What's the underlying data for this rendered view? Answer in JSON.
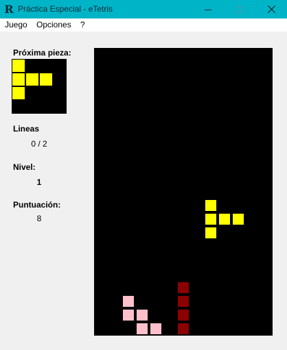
{
  "window": {
    "title": "Práctica Especial - eTetris",
    "icon": "app-logo-icon",
    "icon_glyph": "R",
    "colors": {
      "titlebar": "#00b4c8"
    }
  },
  "menu": {
    "items": [
      {
        "label": "Juego"
      },
      {
        "label": "Opciones"
      },
      {
        "label": "?"
      }
    ]
  },
  "side_panel": {
    "next_piece_label": "Próxima pieza:",
    "lines_label": "Lineas",
    "lines_value": "0 / 2",
    "level_label": "Nivel:",
    "level_value": "1",
    "score_label": "Puntuación:",
    "score_value": "8"
  },
  "next_piece": {
    "grid_size": 4,
    "color": "#ffff00",
    "cells": [
      [
        0,
        0
      ],
      [
        0,
        1
      ],
      [
        1,
        1
      ],
      [
        2,
        1
      ],
      [
        0,
        2
      ]
    ]
  },
  "board": {
    "columns": 13,
    "rows": 21,
    "background": "#000000",
    "blocks": [
      {
        "col": 8,
        "row": 11,
        "color": "#ffff00"
      },
      {
        "col": 8,
        "row": 12,
        "color": "#ffff00"
      },
      {
        "col": 9,
        "row": 12,
        "color": "#ffff00"
      },
      {
        "col": 10,
        "row": 12,
        "color": "#ffff00"
      },
      {
        "col": 8,
        "row": 13,
        "color": "#ffff00"
      },
      {
        "col": 6,
        "row": 17,
        "color": "#8b0000"
      },
      {
        "col": 6,
        "row": 18,
        "color": "#8b0000"
      },
      {
        "col": 6,
        "row": 19,
        "color": "#8b0000"
      },
      {
        "col": 6,
        "row": 20,
        "color": "#8b0000"
      },
      {
        "col": 2,
        "row": 18,
        "color": "#ffc0cb"
      },
      {
        "col": 2,
        "row": 19,
        "color": "#ffc0cb"
      },
      {
        "col": 3,
        "row": 19,
        "color": "#ffc0cb"
      },
      {
        "col": 3,
        "row": 20,
        "color": "#ffc0cb"
      },
      {
        "col": 4,
        "row": 20,
        "color": "#ffc0cb"
      }
    ]
  }
}
